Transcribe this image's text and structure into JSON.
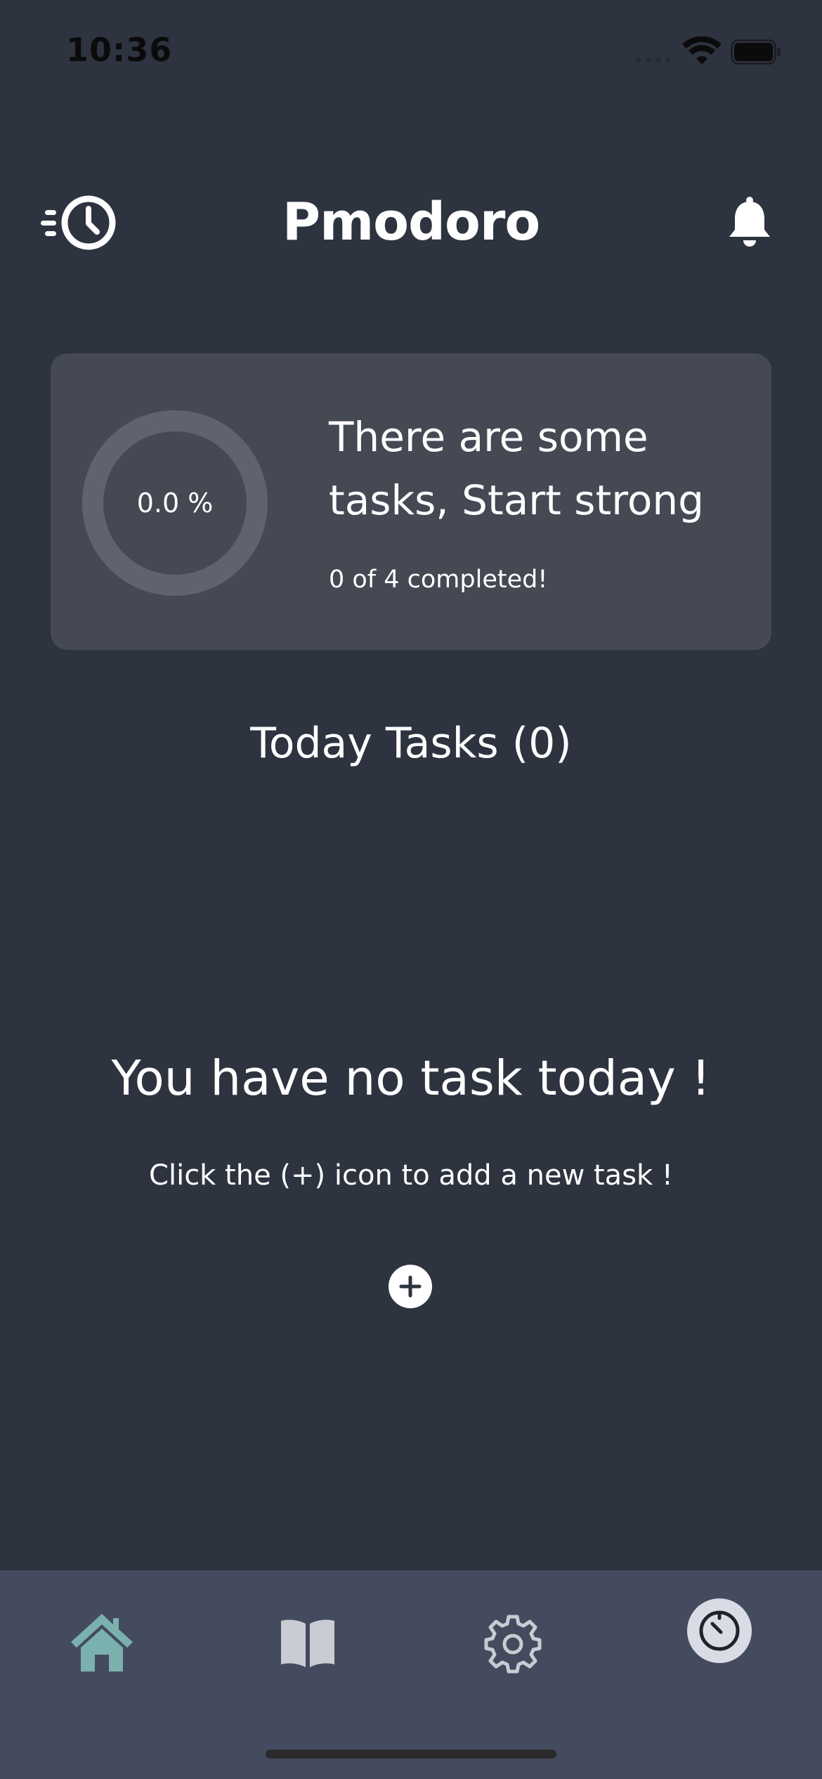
{
  "status_bar": {
    "time": "10:36"
  },
  "header": {
    "title": "Pmodoro",
    "left_icon": "history-clock-icon",
    "right_icon": "bell-icon"
  },
  "progress_card": {
    "percent_label": "0.0 %",
    "progress_fraction": 0.0,
    "message_line1": "There are some",
    "message_line2": "tasks, Start strong",
    "count_text": "0 of 4 completed!"
  },
  "tasks_section": {
    "heading": "Today Tasks (0)"
  },
  "empty_state": {
    "title": "You have no task today !",
    "subtitle": "Click the (+) icon to add a new task !",
    "add_icon": "plus-icon"
  },
  "bottom_nav": {
    "items": [
      {
        "icon": "home-icon",
        "active": true
      },
      {
        "icon": "book-icon",
        "active": false
      },
      {
        "icon": "gear-icon",
        "active": false
      },
      {
        "icon": "timer-icon",
        "active": false
      }
    ]
  },
  "colors": {
    "background": "#2e3340",
    "card": "#444954",
    "ring_track": "#5f636d",
    "nav_background": "#444b5e",
    "home_active": "#7ab0ad",
    "nav_inactive": "#c9ccd3"
  }
}
